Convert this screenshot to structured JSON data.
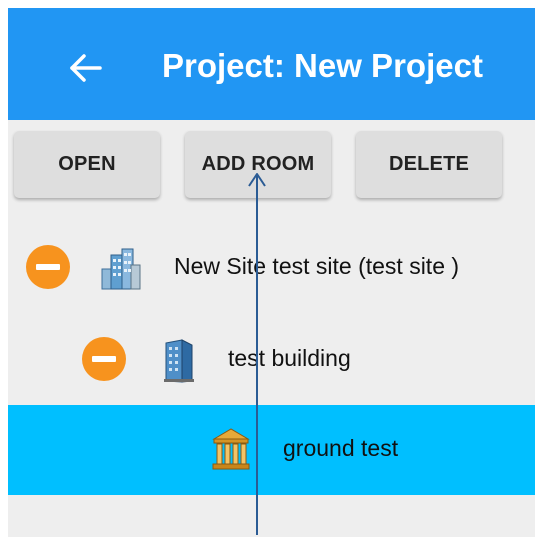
{
  "appbar": {
    "back_icon": "arrow-left-icon",
    "title": "Project: New Project",
    "color": "#2196f3"
  },
  "toolbar": {
    "open_label": "OPEN",
    "add_room_label": "ADD ROOM",
    "delete_label": "DELETE"
  },
  "tree": {
    "items": [
      {
        "label": "New Site test site  (test site )",
        "icon": "site-buildings-icon",
        "level": 0,
        "collapsible": true,
        "selected": false
      },
      {
        "label": "test building",
        "icon": "building-icon",
        "level": 1,
        "collapsible": true,
        "selected": false
      },
      {
        "label": "ground test",
        "icon": "floor-columns-icon",
        "level": 2,
        "collapsible": false,
        "selected": true
      }
    ],
    "selected_color": "#00bfff",
    "collapse_color": "#f7931e"
  },
  "annotation": {
    "icon": "pointer-arrow-icon",
    "color": "#2a5b94"
  }
}
